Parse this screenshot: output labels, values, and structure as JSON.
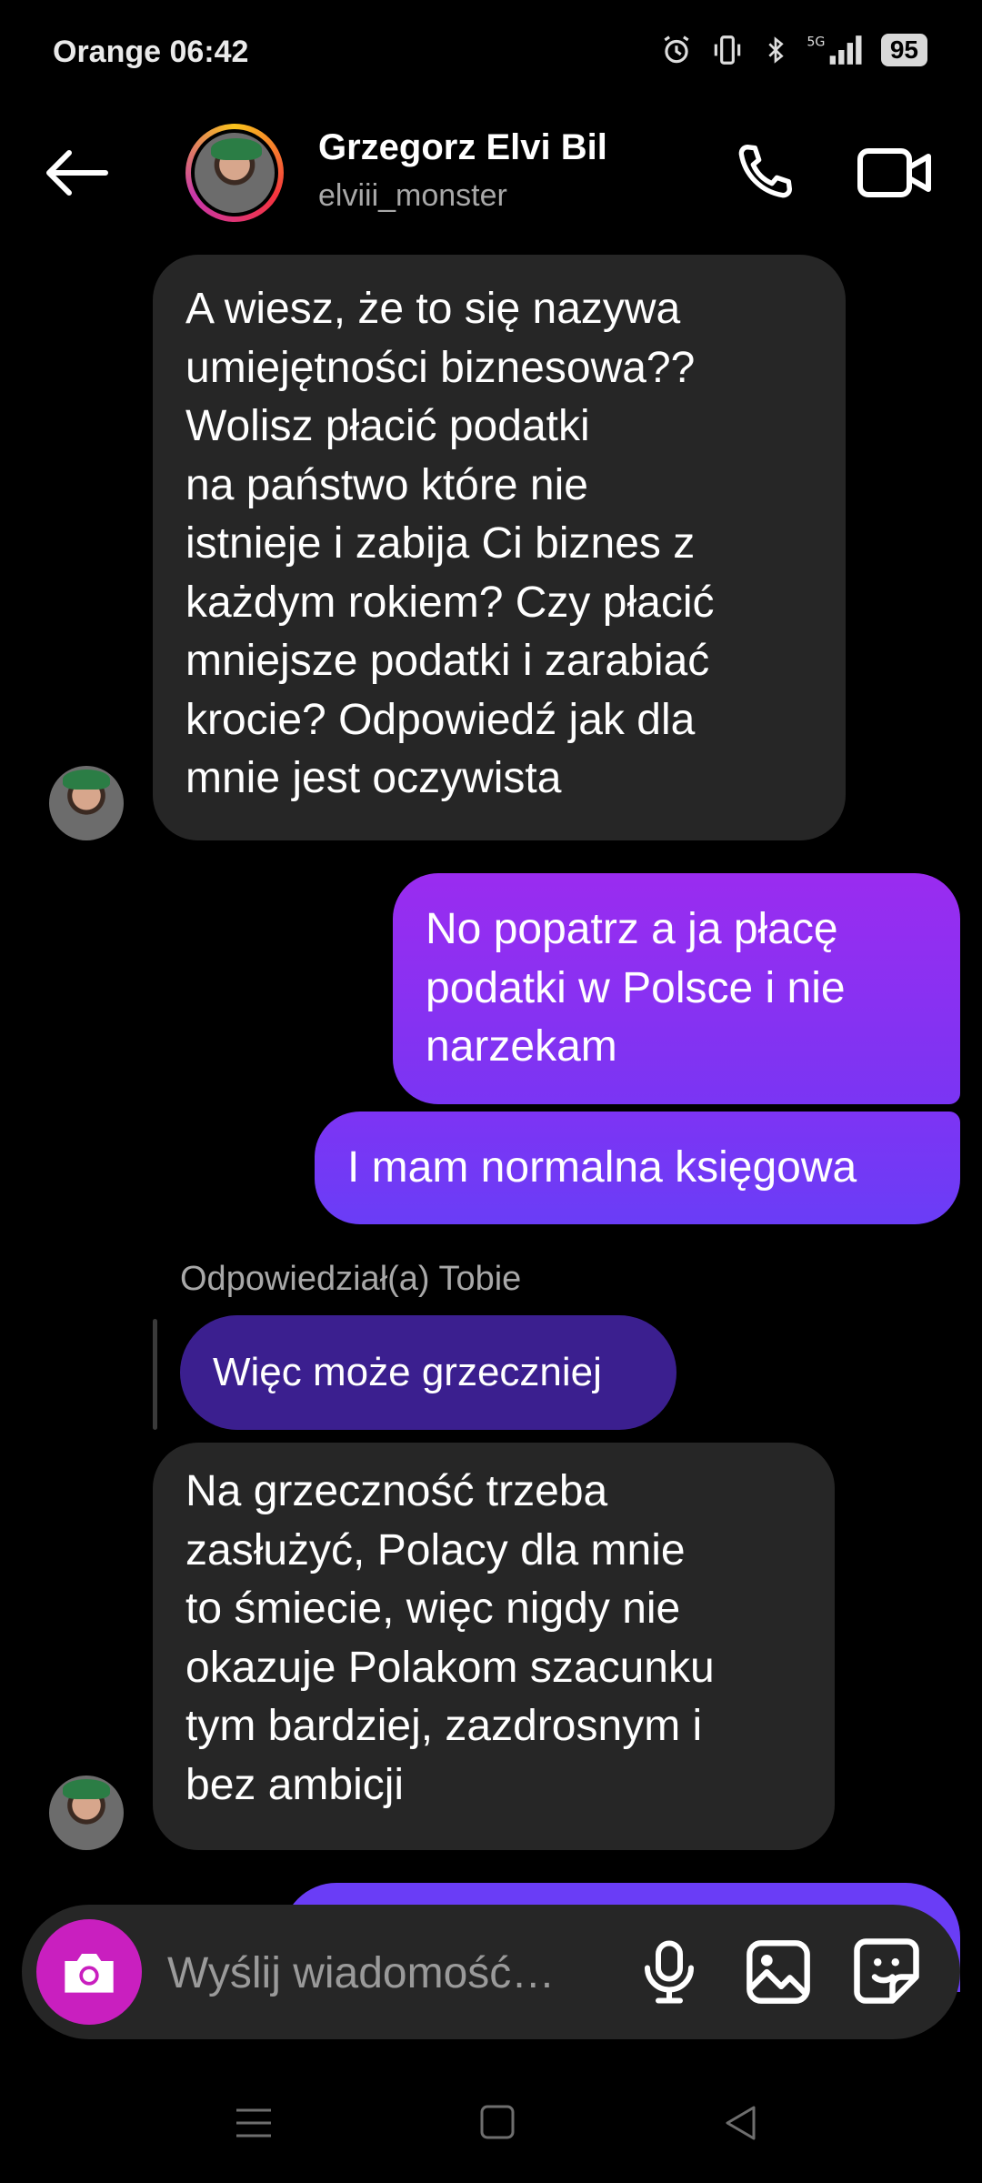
{
  "status_bar": {
    "carrier_time": "Orange 06:42",
    "battery": "95",
    "icons": [
      "alarm-icon",
      "vibrate-icon",
      "bluetooth-icon",
      "5g-signal-icon"
    ]
  },
  "header": {
    "name": "Grzegorz Elvi Bil",
    "handle": "elviii_monster",
    "back_icon": "arrow-left-icon",
    "call_icon": "phone-icon",
    "video_icon": "video-camera-icon"
  },
  "messages": [
    {
      "from": "them",
      "text": "A wiesz, że to się nazywa\numiejętności biznesowa??\nWolisz płacić podatki\nna państwo które nie\nistnieje i zabija Ci biznes z\nkażdym rokiem? Czy płacić\nmniejsze podatki i zarabiać\nkrocie? Odpowiedź jak dla\nmnie jest oczywista"
    },
    {
      "from": "me",
      "text": "No popatrz a ja płacę\npodatki w Polsce i nie\nnarzekam"
    },
    {
      "from": "me",
      "text": "I mam normalna księgowa"
    },
    {
      "from": "them",
      "reply_label": "Odpowiedział(a) Tobie",
      "quoted": "Więc może grzeczniej",
      "text": "Na grzeczność trzeba\nzasłużyć, Polacy dla mnie\nto śmiecie, więc nigdy nie\nokazuje Polakom szacunku\ntym bardziej, zazdrosnym i\nbez ambicji"
    }
  ],
  "composer": {
    "placeholder": "Wyślij wiadomość…",
    "icons": [
      "camera-icon",
      "microphone-icon",
      "image-icon",
      "sticker-icon"
    ]
  },
  "colors": {
    "background": "#000000",
    "incoming_bubble": "#262626",
    "outgoing_gradient_top": "#9a2cf0",
    "outgoing_gradient_bottom": "#6d3cf5",
    "camera_button": "#c91fbf"
  }
}
